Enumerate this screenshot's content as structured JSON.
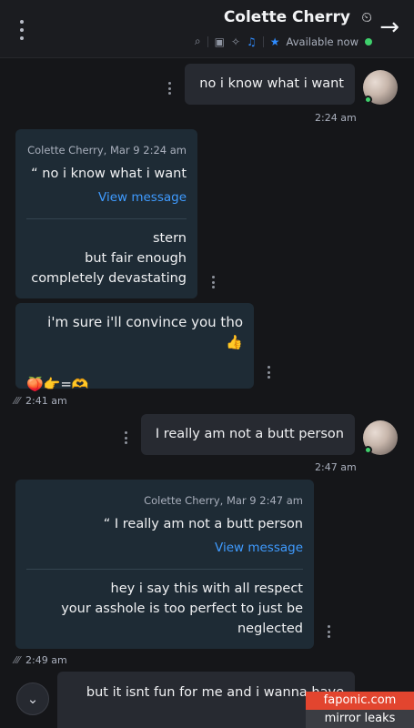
{
  "header": {
    "contact_name": "Colette Cherry",
    "name_emoji": "⏲",
    "status": "Available now",
    "back_icon": "→"
  },
  "messages": [
    {
      "text": "no i know what i want",
      "time": "2:24 am"
    },
    {
      "quote_author": "Colette Cherry, Mar 9 2:24 am",
      "quote_text": "“ no i know what i want",
      "view_link": "View message",
      "reply": "stern\nbut fair enough\ncompletely devastating"
    },
    {
      "text": "i'm sure i'll convince you tho 👍",
      "emoji_line": "🍑👉=🫶",
      "time": "2:41 am"
    },
    {
      "text": "I really am not a butt person",
      "time": "2:47 am"
    },
    {
      "quote_author": "Colette Cherry, Mar 9 2:47 am",
      "quote_text": "“ I really am not a butt person",
      "view_link": "View message",
      "reply": "hey i say this with all respect\nyour asshole is too perfect to just be\nneglected",
      "time": "2:49 am"
    },
    {
      "text": "but it isnt fun for me and i wanna have"
    }
  ],
  "scroll_down_icon": "⌄",
  "watermark": {
    "top": "faponic.com",
    "bottom": "mirror leaks"
  },
  "colors": {
    "accent": "#2f8cff",
    "online": "#3fd06c",
    "incoming_bubble": "#1e2b35",
    "outgoing_bubble": "#272a31",
    "watermark_red": "#e2452f"
  }
}
